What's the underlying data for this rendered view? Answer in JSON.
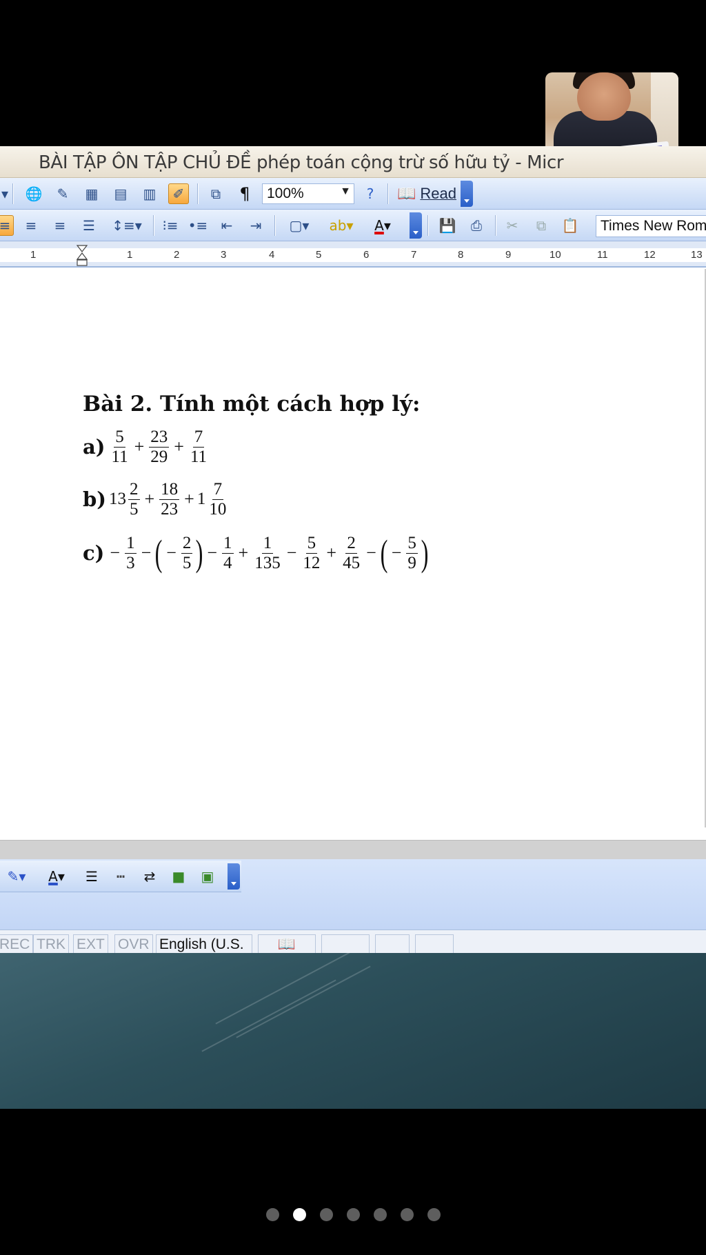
{
  "window": {
    "title": "BÀI TẬP ÔN TẬP CHỦ ĐỀ phép toán cộng trừ số hữu tỷ - Micr"
  },
  "toolbar": {
    "zoom_value": "100%",
    "read_label": "Read",
    "paragraph_mark": "¶",
    "font_name": "Times New Rom"
  },
  "ruler": {
    "numbers": [
      "1",
      "1",
      "2",
      "3",
      "4",
      "5",
      "6",
      "7",
      "8",
      "9",
      "10",
      "11",
      "12",
      "13"
    ]
  },
  "document": {
    "title": "Bài 2. Tính một cách hợp lý:",
    "problems": {
      "a": {
        "label": "a)",
        "f1_num": "5",
        "f1_den": "11",
        "op1": "+",
        "f2_num": "23",
        "f2_den": "29",
        "op2": "+",
        "f3_num": "7",
        "f3_den": "11"
      },
      "b": {
        "label": "b)",
        "w1": "13",
        "f1_num": "2",
        "f1_den": "5",
        "op1": "+",
        "f2_num": "18",
        "f2_den": "23",
        "op2": "+",
        "w3": "1",
        "f3_num": "7",
        "f3_den": "10"
      },
      "c": {
        "label": "c)",
        "sign1": "−",
        "f1_num": "1",
        "f1_den": "3",
        "op1": "−",
        "lp1": "(",
        "sign2": "−",
        "f2_num": "2",
        "f2_den": "5",
        "rp1": ")",
        "op2": "−",
        "f3_num": "1",
        "f3_den": "4",
        "op3": "+",
        "f4_num": "1",
        "f4_den": "135",
        "op4": "−",
        "f5_num": "5",
        "f5_den": "12",
        "op5": "+",
        "f6_num": "2",
        "f6_den": "45",
        "op6": "−",
        "lp2": "(",
        "sign3": "−",
        "f7_num": "5",
        "f7_den": "9",
        "rp2": ")"
      }
    }
  },
  "status_bar": {
    "rec": "REC",
    "trk": "TRK",
    "ext": "EXT",
    "ovr": "OVR",
    "language": "English (U.S."
  },
  "pager": {
    "count": 7,
    "active_index": 1
  },
  "colors": {
    "toolbar_bg": "#c5d8f5",
    "active_button": "#f7a83d",
    "desktop": "#2c4f5a"
  }
}
